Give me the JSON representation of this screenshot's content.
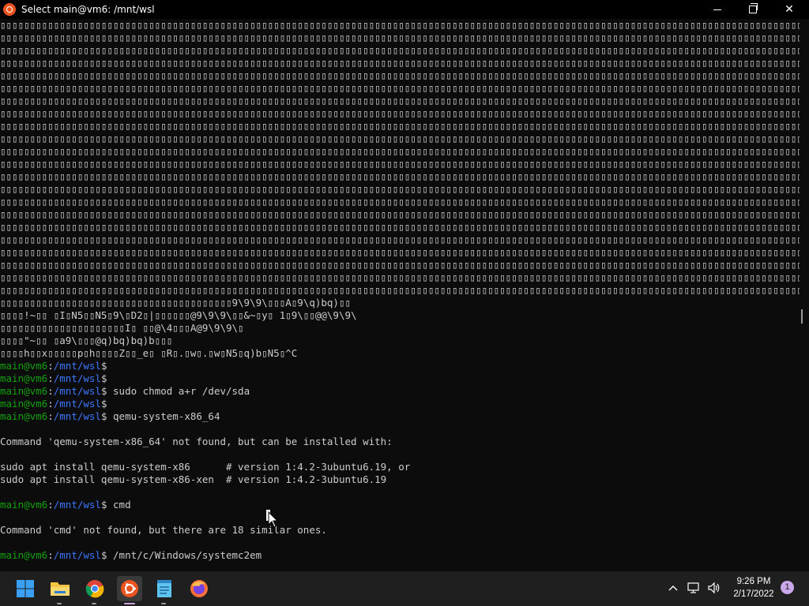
{
  "window": {
    "title": "Select main@vm6: /mnt/wsl",
    "minimize_icon": "minimize-icon",
    "maximize_icon": "restore-icon",
    "close_glyph": "✕"
  },
  "terminal": {
    "garbage_line": "▯▯▯▯▯▯▯▯▯▯▯▯▯▯▯▯▯▯▯▯▯▯▯▯▯▯▯▯▯▯▯▯▯▯▯▯▯▯▯▯▯▯▯▯▯▯▯▯▯▯▯▯▯▯▯▯▯▯▯▯▯▯▯▯▯▯▯▯▯▯▯▯▯▯▯▯▯▯▯▯▯▯▯▯▯▯▯▯▯▯▯▯▯▯▯▯▯▯▯▯▯▯▯▯▯▯▯▯▯▯▯▯▯▯▯▯▯▯▯▯▯▯▯▯▯▯▯▯▯▯▯▯▯▯▯▯▯▯▯▯▯▯▯▯▯▯▯▯▯▯",
    "garbage_line_count": 22,
    "tail_lines": [
      "▯▯▯▯▯▯▯▯▯▯▯▯▯▯▯▯▯▯▯▯▯▯▯▯▯▯▯▯▯▯▯▯▯▯▯▯▯▯▯9\\9\\9\\▯▯▯A▯9\\q)bq)▯▯",
      "▯▯▯▯!~▯▯ ▯I▯N5▯▯N5▯9\\▯D2▯|▯▯▯▯▯▯@9\\9\\9\\▯▯&~▯y▯ 1▯9\\▯▯@@\\9\\9\\",
      "▯▯▯▯▯▯▯▯▯▯▯▯▯▯▯▯▯▯▯▯▯I▯ ▯▯@\\4▯▯▯A@9\\9\\9\\▯",
      "▯▯▯▯\"~▯▯ ▯a9\\▯▯▯@q)bq)bq)b▯▯▯",
      "▯▯▯▯h▯▯x▯▯▯▯▯p▯h▯▯▯▯Z▯▯_e▯ ▯R▯.▯w▯.▯w▯N5▯q)b▯N5▯^C"
    ],
    "prompt_user": "main@vm6",
    "prompt_sep": ":",
    "prompt_path": "/mnt/wsl",
    "prompt_dollar": "$",
    "prompts": [
      {
        "cmd": ""
      },
      {
        "cmd": ""
      },
      {
        "cmd": " sudo chmod a+r /dev/sda"
      },
      {
        "cmd": ""
      },
      {
        "cmd": " qemu-system-x86_64"
      }
    ],
    "output_1": "Command 'qemu-system-x86_64' not found, but can be installed with:",
    "output_2": "sudo apt install qemu-system-x86      # version 1:4.2-3ubuntu6.19, or",
    "output_3": "sudo apt install qemu-system-x86-xen  # version 1:4.2-3ubuntu6.19",
    "cmd_prompt": {
      "cmd": " cmd"
    },
    "output_4": "Command 'cmd' not found, but there are 18 similar ones.",
    "last_prompt": {
      "cmd": " /mnt/c/Windows/systemc2em"
    }
  },
  "taskbar": {
    "apps": [
      {
        "name": "start-button",
        "icon": "windows-start-icon"
      },
      {
        "name": "file-explorer",
        "icon": "folder-icon"
      },
      {
        "name": "chrome",
        "icon": "chrome-icon"
      },
      {
        "name": "ubuntu-terminal",
        "icon": "ubuntu-icon",
        "active": true
      },
      {
        "name": "notepad",
        "icon": "notepad-icon"
      },
      {
        "name": "firefox",
        "icon": "firefox-icon"
      }
    ],
    "tray_chevron": "^",
    "clock_time": "9:26 PM",
    "clock_date": "2/17/2022",
    "notification_count": "1"
  },
  "colors": {
    "prompt_user": "#13a10e",
    "prompt_path": "#3b78ff",
    "terminal_bg": "#0c0c0c",
    "taskbar_bg": "#1f1f1f",
    "ubuntu_orange": "#e95420"
  }
}
